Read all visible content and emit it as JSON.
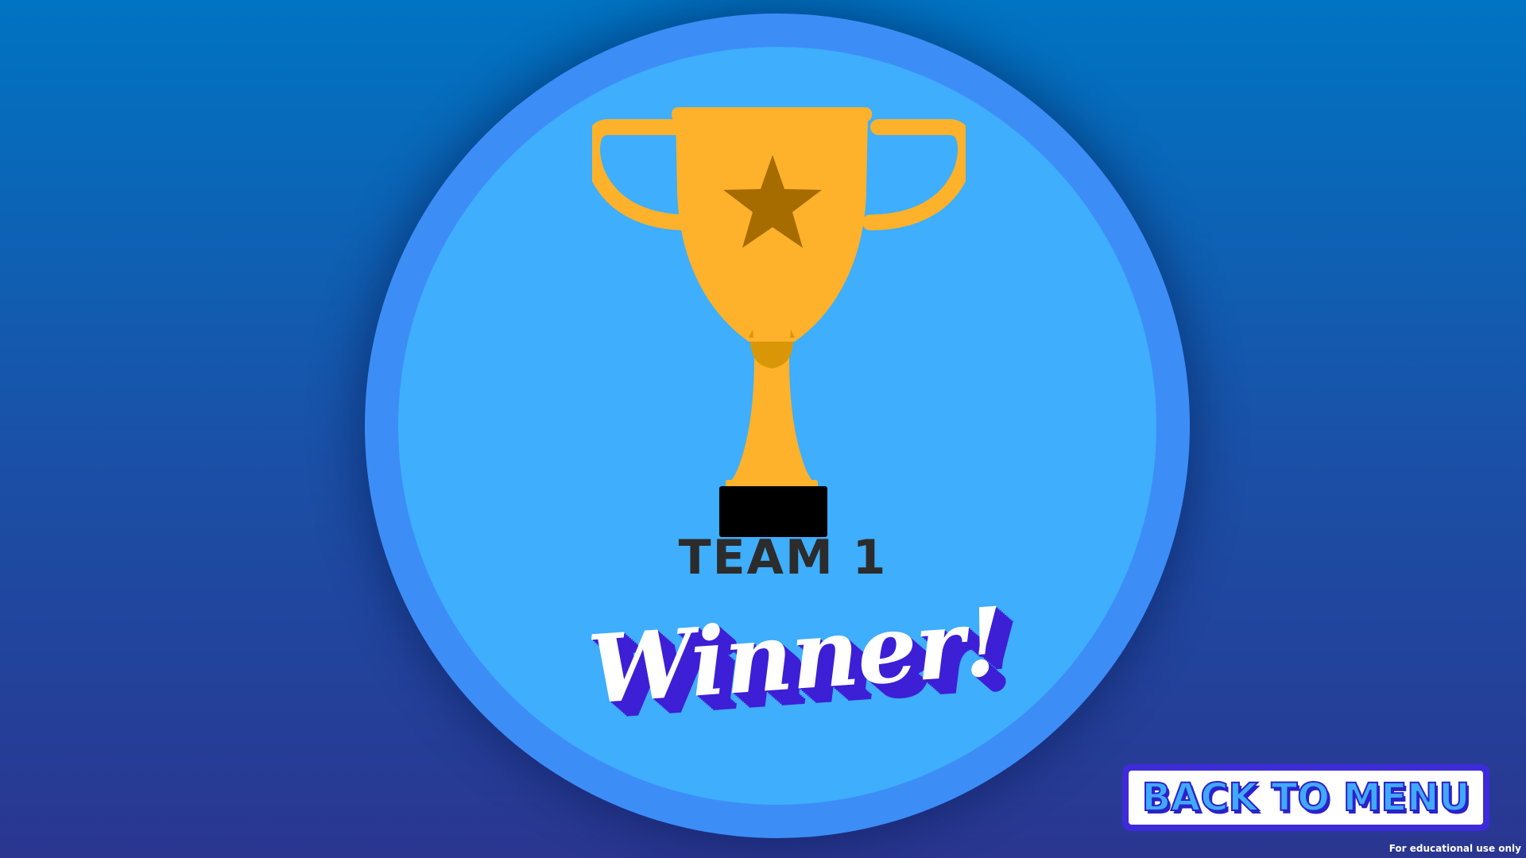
{
  "result": {
    "team_label": "TEAM 1",
    "winner_label": "Winner!"
  },
  "navigation": {
    "back_button_label": "BACK TO MENU"
  },
  "footer": {
    "note": "For educational use only"
  },
  "icons": {
    "trophy": "trophy-icon",
    "star": "star-icon"
  },
  "colors": {
    "background_top": "#0074c2",
    "background_bottom": "#2a3690",
    "medal_ring": "#3d8df7",
    "medal_face": "#3eaefd",
    "trophy_gold": "#feb12a",
    "trophy_shade": "#d99708",
    "star": "#a66c00",
    "trophy_base": "#000000",
    "winner_shadow": "#3d1fd6",
    "button_border": "#3d2bd9",
    "button_text": "#41a9fb"
  }
}
